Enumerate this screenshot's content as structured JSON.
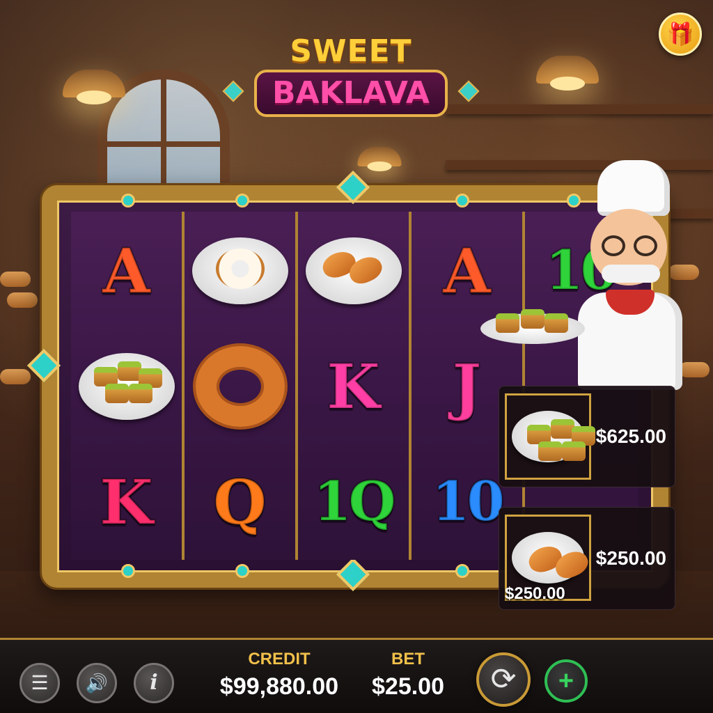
{
  "game": {
    "title_line1": "SWEET",
    "title_line2": "BAKLAVA"
  },
  "top_right": {
    "icon": "gift-icon"
  },
  "reels": [
    {
      "symbols": [
        {
          "kind": "letter",
          "text": "A",
          "color": "#ff5a2a"
        },
        {
          "kind": "food",
          "food": "baklava"
        },
        {
          "kind": "letter",
          "text": "K",
          "color": "#ff2f6e"
        }
      ]
    },
    {
      "symbols": [
        {
          "kind": "food",
          "food": "donut"
        },
        {
          "kind": "food",
          "food": "churro-ring"
        },
        {
          "kind": "letter",
          "text": "Q",
          "color": "#ff7a1a"
        }
      ]
    },
    {
      "symbols": [
        {
          "kind": "food",
          "food": "madeleines"
        },
        {
          "kind": "letter",
          "text": "K",
          "color": "#ff3fa6"
        },
        {
          "kind": "letter",
          "text": "1Q",
          "color": "#2fd43a"
        }
      ]
    },
    {
      "symbols": [
        {
          "kind": "letter",
          "text": "A",
          "color": "#ff5a2a"
        },
        {
          "kind": "letter",
          "text": "J",
          "color": "#ff3f9e"
        },
        {
          "kind": "letter",
          "text": "10",
          "color": "#2a8cff"
        }
      ]
    },
    {
      "symbols": [
        {
          "kind": "letter",
          "text": "10",
          "color": "#2fd43a"
        },
        {
          "kind": "blank"
        },
        {
          "kind": "blank"
        }
      ]
    }
  ],
  "wins": [
    {
      "symbol": "baklava",
      "amount": "$625.00",
      "overlay": ""
    },
    {
      "symbol": "madeleines",
      "amount": "$250.00",
      "overlay": "$250.00"
    }
  ],
  "controls": {
    "menu_icon": "menu-icon",
    "sound_icon": "speaker-icon",
    "info_icon": "info-icon",
    "info_glyph": "i",
    "credit_label": "CREDIT",
    "credit_value": "$99,880.00",
    "bet_label": "BET",
    "bet_value": "$25.00",
    "spin_icon": "refresh-icon",
    "plus_icon": "plus-icon"
  },
  "colors": {
    "gold": "#b08433",
    "accent_green": "#2fbf54",
    "label_gold": "#f0c04a"
  }
}
